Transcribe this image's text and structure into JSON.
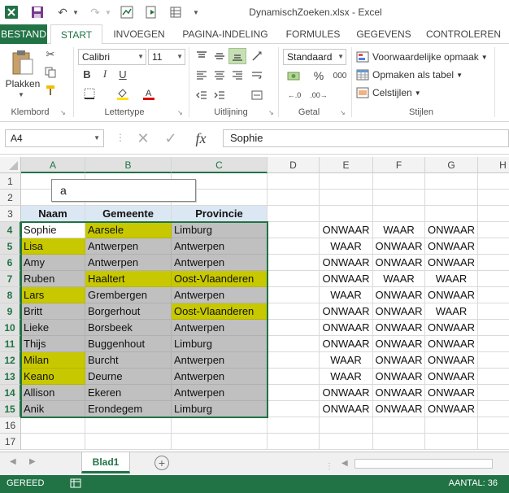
{
  "window": {
    "title": "DynamischZoeken.xlsx - Excel"
  },
  "ribbon_tabs": [
    "BESTAND",
    "START",
    "INVOEGEN",
    "PAGINA-INDELING",
    "FORMULES",
    "GEGEVENS",
    "CONTROLEREN"
  ],
  "ribbon": {
    "paste_label": "Plakken",
    "font_name": "Calibri",
    "font_size": "11",
    "number_format": "Standaard",
    "percent_symbol": "%",
    "thousands_symbol": "000",
    "conditional_formatting": "Voorwaardelijke opmaak",
    "format_as_table": "Opmaken als tabel",
    "cell_styles": "Celstijlen",
    "groups": [
      "Klembord",
      "Lettertype",
      "Uitlijning",
      "Getal",
      "Stijlen"
    ],
    "bold": "B",
    "italic": "I",
    "underline": "U"
  },
  "formula_bar": {
    "name_box": "A4",
    "formula": "Sophie",
    "fx_label": "fx"
  },
  "grid": {
    "columns": [
      "A",
      "B",
      "C",
      "D",
      "E",
      "F",
      "G",
      "H"
    ],
    "rows": [
      "1",
      "2",
      "3",
      "4",
      "5",
      "6",
      "7",
      "8",
      "9",
      "10",
      "11",
      "12",
      "13",
      "14",
      "15",
      "16",
      "17"
    ],
    "search_value": "a",
    "headers": [
      "Naam",
      "Gemeente",
      "Provincie"
    ],
    "table": [
      [
        "Sophie",
        "Aarsele",
        "Limburg"
      ],
      [
        "Lisa",
        "Antwerpen",
        "Antwerpen"
      ],
      [
        "Amy",
        "Antwerpen",
        "Antwerpen"
      ],
      [
        "Ruben",
        "Haaltert",
        "Oost-Vlaanderen"
      ],
      [
        "Lars",
        "Grembergen",
        "Antwerpen"
      ],
      [
        "Britt",
        "Borgerhout",
        "Oost-Vlaanderen"
      ],
      [
        "Lieke",
        "Borsbeek",
        "Antwerpen"
      ],
      [
        "Thijs",
        "Buggenhout",
        "Limburg"
      ],
      [
        "Milan",
        "Burcht",
        "Antwerpen"
      ],
      [
        "Keano",
        "Deurne",
        "Antwerpen"
      ],
      [
        "Allison",
        "Ekeren",
        "Antwerpen"
      ],
      [
        "Anik",
        "Erondegem",
        "Limburg"
      ]
    ],
    "highlight": [
      [
        false,
        true,
        false
      ],
      [
        true,
        false,
        false
      ],
      [
        false,
        false,
        false
      ],
      [
        false,
        true,
        true
      ],
      [
        true,
        false,
        false
      ],
      [
        false,
        false,
        true
      ],
      [
        false,
        false,
        false
      ],
      [
        false,
        false,
        false
      ],
      [
        true,
        false,
        false
      ],
      [
        true,
        false,
        false
      ],
      [
        false,
        false,
        false
      ],
      [
        false,
        false,
        false
      ]
    ],
    "flags": [
      [
        "ONWAAR",
        "WAAR",
        "ONWAAR"
      ],
      [
        "WAAR",
        "ONWAAR",
        "ONWAAR"
      ],
      [
        "ONWAAR",
        "ONWAAR",
        "ONWAAR"
      ],
      [
        "ONWAAR",
        "WAAR",
        "WAAR"
      ],
      [
        "WAAR",
        "ONWAAR",
        "ONWAAR"
      ],
      [
        "ONWAAR",
        "ONWAAR",
        "WAAR"
      ],
      [
        "ONWAAR",
        "ONWAAR",
        "ONWAAR"
      ],
      [
        "ONWAAR",
        "ONWAAR",
        "ONWAAR"
      ],
      [
        "WAAR",
        "ONWAAR",
        "ONWAAR"
      ],
      [
        "WAAR",
        "ONWAAR",
        "ONWAAR"
      ],
      [
        "ONWAAR",
        "ONWAAR",
        "ONWAAR"
      ],
      [
        "ONWAAR",
        "ONWAAR",
        "ONWAAR"
      ]
    ]
  },
  "sheets": {
    "active": "Blad1"
  },
  "status": {
    "mode": "GEREED",
    "count": "AANTAL: 36"
  },
  "colors": {
    "accent": "#217346",
    "highlight": "#c8c800",
    "range_fill": "#c0c0c0",
    "header_fill": "#dbe7f3"
  }
}
